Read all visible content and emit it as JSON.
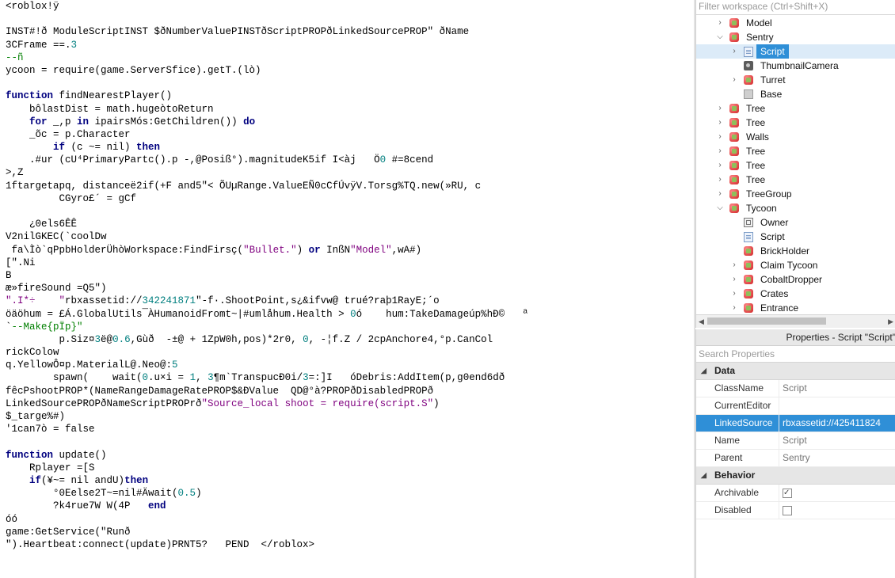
{
  "editor": {
    "lines": [
      "<roblox!ÿ",
      "",
      "INST#!ð ModuleScriptINST $ðNumberValuePINSTðScriptPROPðLinkedSourcePROP\" ðName",
      "3CFrame ==.3",
      "--ñ",
      "ycoon = require(game.ServerSfice).getT.(lò)",
      "",
      "function findNearestPlayer()",
      "    bôlastDist = math.hugeòtoReturn",
      "    for _,p in ipairsMós:GetChildren()) do",
      "    _õc = p.Character",
      "        if (c ~= nil) then",
      "    .#ur (cU⁴PrimaryPartc().p -,@Posiß°).magnitudeK5if I<àj   Ö0 #=8cend",
      ">,Z",
      "1ftargetapq, distanceë2if(+F and5\"< ÕUµRange.ValueEÑ0cCfÚvÿV.Torsg%TQ.new(»RU, c",
      "         CGyro£´ = gCf",
      "",
      "    ¿0els6ÊÊ",
      "V2nilGKEC(`coolDw",
      " fa\\Ìò`qPpbHolderÜhòWorkspace:FindFirsç(\"Bullet.\") or InßN\"Model\",wA#)",
      "[\".Ni",
      "B",
      "æ»fireSound =Q5\")",
      "\".I*÷    \"rbxassetid://342241871\"-f·.ShootPoint,s¿&ifvw@ trué?raþ1RayE;´o",
      "öäöhum = £Á.GlobalUtils¯ÀHumanoidFromt~|#umlåhum.Health > 0ó    hum:TakeDamageúp%hÐ©   ª",
      "`--Make{pÏp}\"",
      "         p.Siz¤3ë@0.6,Gùð  -±@ + 1ZpW0h,pos)*2r0, 0, -¦f.Z / 2cpAnchore4,°p.CanCol",
      "rickColow",
      "q.YellowÔ¤p.MaterialL@.Neo@:5",
      "        spawn(    wait(0.u×i = 1, 3¶m`TranspucÐ0i/3=:]I   óDebris:AddItem(p,g0end6dð",
      "fêcPshootPROP*(NameRangeDamageRatePROP$&ÐValue  QD@°à?PROPðDisabledPROPð",
      "LinkedSourcePROPðNameScriptPROPrð\"Source_local shoot = require(script.S\")",
      "$_targe%#)",
      "'1can7ò = false",
      "",
      "function update()",
      "    Rplayer =[S",
      "    if(¥~= nil andU)then",
      "        °0Eelse2T~=nil#Äwait(0.5)",
      "        ?k4rue7W W(4P   end",
      "óó",
      "game:GetService(\"Runð",
      "\").Heartbeat:connect(update)PRNT5?   PEND  </roblox>"
    ]
  },
  "explorer": {
    "filter_placeholder": "Filter workspace (Ctrl+Shift+X)",
    "items": [
      {
        "label": "Model",
        "icon": "model-icon",
        "expander": "collapsed"
      },
      {
        "label": "Sentry",
        "icon": "model-icon",
        "expander": "expanded"
      },
      {
        "label": "Script",
        "icon": "script-icon",
        "expander": "collapsed",
        "selected": true
      },
      {
        "label": "ThumbnailCamera",
        "icon": "camera-icon",
        "expander": "none"
      },
      {
        "label": "Turret",
        "icon": "model-icon",
        "expander": "collapsed"
      },
      {
        "label": "Base",
        "icon": "part-icon",
        "expander": "none"
      },
      {
        "label": "Tree",
        "icon": "model-icon",
        "expander": "collapsed"
      },
      {
        "label": "Tree",
        "icon": "model-icon",
        "expander": "collapsed"
      },
      {
        "label": "Walls",
        "icon": "model-icon",
        "expander": "collapsed"
      },
      {
        "label": "Tree",
        "icon": "model-icon",
        "expander": "collapsed"
      },
      {
        "label": "Tree",
        "icon": "model-icon",
        "expander": "collapsed"
      },
      {
        "label": "Tree",
        "icon": "model-icon",
        "expander": "collapsed"
      },
      {
        "label": "TreeGroup",
        "icon": "model-icon",
        "expander": "collapsed"
      },
      {
        "label": "Tycoon",
        "icon": "model-icon",
        "expander": "expanded"
      },
      {
        "label": "Owner",
        "icon": "value-icon",
        "expander": "none"
      },
      {
        "label": "Script",
        "icon": "script-icon",
        "expander": "none"
      },
      {
        "label": "BrickHolder",
        "icon": "model-icon",
        "expander": "none"
      },
      {
        "label": "Claim Tycoon",
        "icon": "model-icon",
        "expander": "collapsed"
      },
      {
        "label": "CobaltDropper",
        "icon": "model-icon",
        "expander": "collapsed"
      },
      {
        "label": "Crates",
        "icon": "model-icon",
        "expander": "collapsed"
      },
      {
        "label": "Entrance",
        "icon": "model-icon",
        "expander": "collapsed"
      }
    ]
  },
  "properties": {
    "title": "Properties - Script \"Script\"",
    "search_placeholder": "Search Properties",
    "sections": [
      {
        "name": "Data",
        "rows": [
          {
            "name": "ClassName",
            "value": "Script"
          },
          {
            "name": "CurrentEditor",
            "value": ""
          },
          {
            "name": "LinkedSource",
            "value": "rbxassetid://425411824",
            "selected": true
          },
          {
            "name": "Name",
            "value": "Script"
          },
          {
            "name": "Parent",
            "value": "Sentry"
          }
        ]
      },
      {
        "name": "Behavior",
        "rows": [
          {
            "name": "Archivable",
            "checkbox": true,
            "checked": true
          },
          {
            "name": "Disabled",
            "checkbox": true,
            "checked": false
          }
        ]
      }
    ]
  },
  "colors": {
    "selection": "#2f8fd7",
    "keyword": "#00007f",
    "string": "#7f007f",
    "number": "#007f7f",
    "comment": "#007f00"
  }
}
